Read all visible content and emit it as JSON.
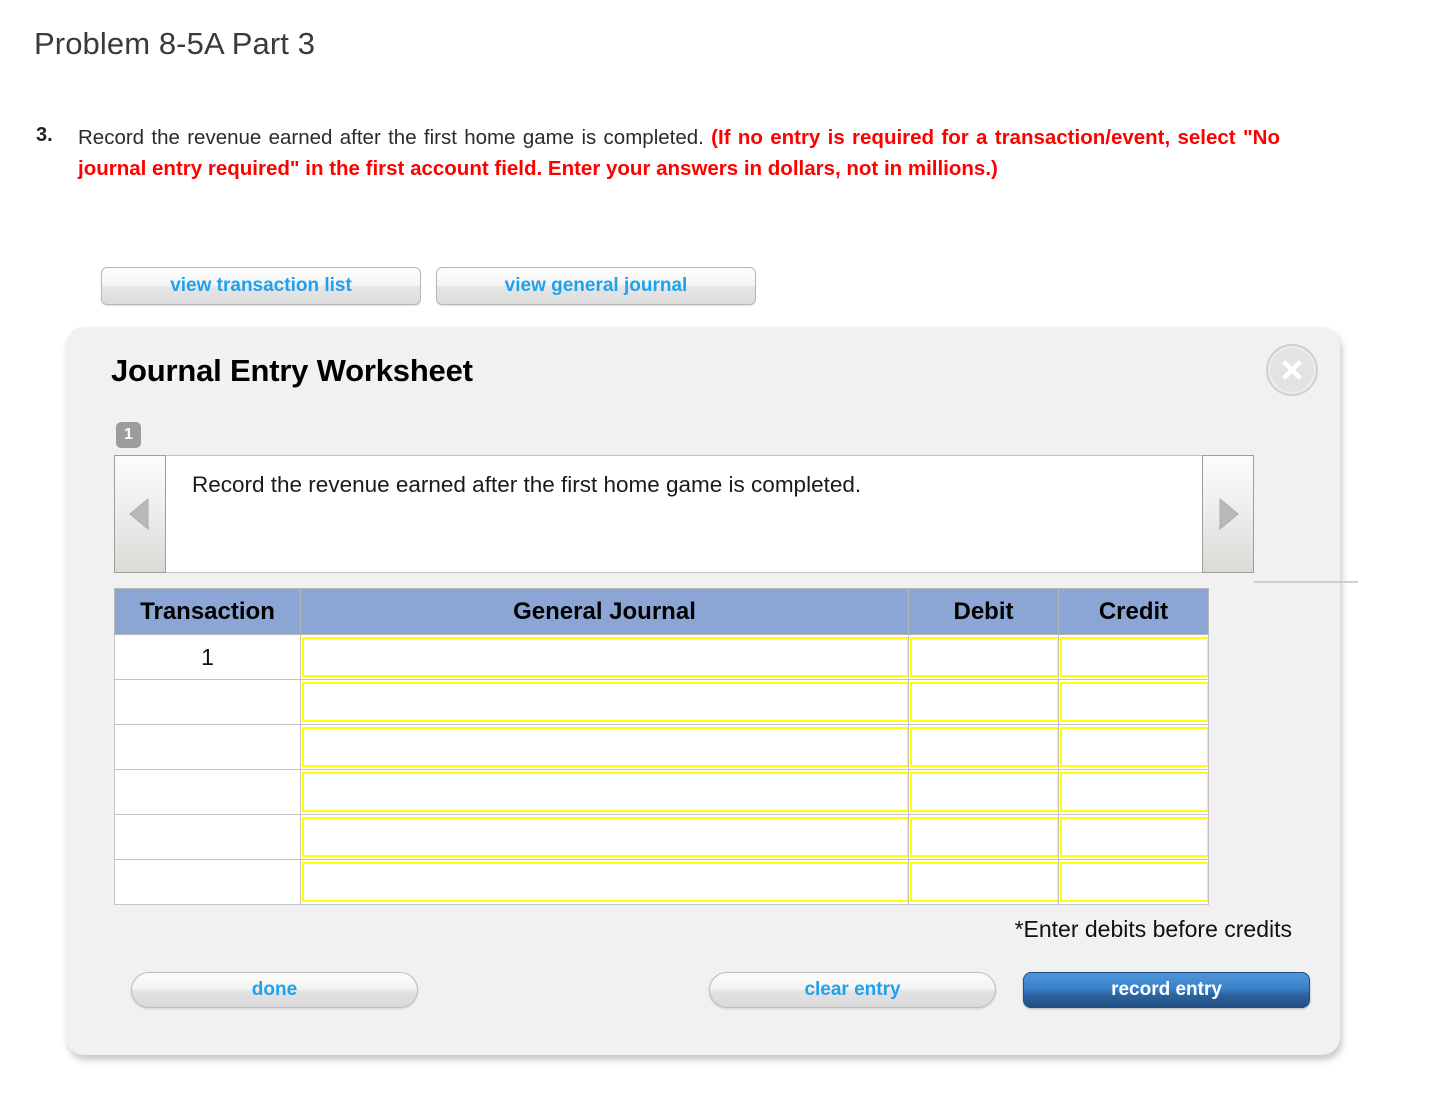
{
  "page": {
    "title": "Problem 8-5A Part 3"
  },
  "question": {
    "number": "3.",
    "text_plain": "Record the revenue earned after the first home game is completed.",
    "text_emphasis": "(If no entry is required for a transaction/event, select \"No journal entry required\" in the first account field. Enter your answers in dollars, not in millions.)"
  },
  "tabs": [
    {
      "label": "view transaction list",
      "name": "view-transaction-list"
    },
    {
      "label": "view general journal",
      "name": "view-general-journal"
    }
  ],
  "worksheet": {
    "title": "Journal Entry Worksheet",
    "close_label": "X",
    "step_badge": "1",
    "prev_arrow": "previous",
    "next_arrow": "next",
    "prompt": "Record the revenue earned after the first home game is completed.",
    "footnote": "*Enter debits before credits",
    "table": {
      "columns": [
        "Transaction",
        "General Journal",
        "Debit",
        "Credit"
      ],
      "rows": [
        {
          "transaction": "1",
          "general_journal": "",
          "debit": "",
          "credit": ""
        },
        {
          "transaction": "",
          "general_journal": "",
          "debit": "",
          "credit": ""
        },
        {
          "transaction": "",
          "general_journal": "",
          "debit": "",
          "credit": ""
        },
        {
          "transaction": "",
          "general_journal": "",
          "debit": "",
          "credit": ""
        },
        {
          "transaction": "",
          "general_journal": "",
          "debit": "",
          "credit": ""
        },
        {
          "transaction": "",
          "general_journal": "",
          "debit": "",
          "credit": ""
        }
      ]
    },
    "buttons": {
      "done": "done",
      "clear_entry": "clear entry",
      "record_entry": "record entry"
    }
  },
  "colors": {
    "emphasis_red": "#ff0000",
    "link_blue": "#1fa2ee",
    "table_header_blue": "#8ba6d5",
    "input_yellow": "#ffff00",
    "record_button_blue": "#3a82cb",
    "panel_gray": "#f1f1f1"
  }
}
